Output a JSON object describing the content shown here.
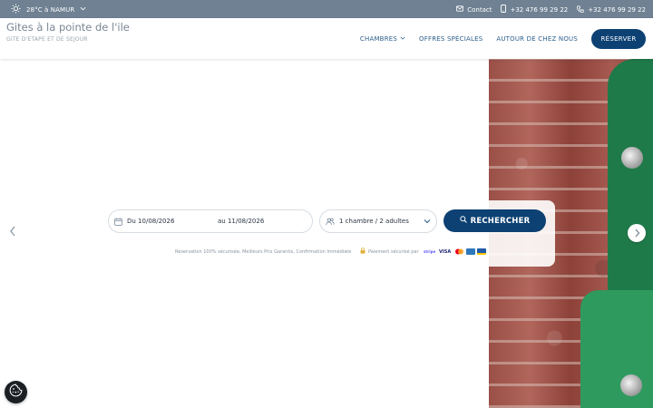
{
  "topbar": {
    "weather": "28°C à NAMUR",
    "contact_label": "Contact",
    "phone_mobile": "+32 476 99 29 22",
    "phone_fixed": "+32 476 99 29 22"
  },
  "header": {
    "title": "Gites à la pointe de l'ile",
    "subtitle": "GITE D'ETAPE ET DE SEJOUR",
    "nav": [
      "CHAMBRES",
      "OFFRES SPÉCIALES",
      "AUTOUR DE CHEZ NOUS"
    ],
    "reserve_label": "RÉSERVER"
  },
  "booking": {
    "date_from": "Du 10/08/2026",
    "date_to": "au 11/08/2026",
    "guests": "1 chambre / 2 adultes",
    "search_label": "RECHERCHER",
    "reassurance": "Réservation 100% sécurisée, Meilleurs Prix Garantis, Confirmation Immédiate",
    "secure_payment": "Paiement sécurisé par",
    "payment_brands": [
      "stripe",
      "VISA",
      "MC",
      "AMEX",
      "BC"
    ]
  },
  "colors": {
    "topbar": "#6f8193",
    "primary": "#0d4173",
    "nav_text": "#2d5f8b"
  },
  "icons": [
    "sun-icon",
    "chevron-down-icon",
    "mail-icon",
    "mobile-icon",
    "phone-icon",
    "calendar-icon",
    "people-icon",
    "search-icon",
    "lock-icon",
    "chevron-left-icon",
    "chevron-right-icon",
    "cookie-icon"
  ]
}
